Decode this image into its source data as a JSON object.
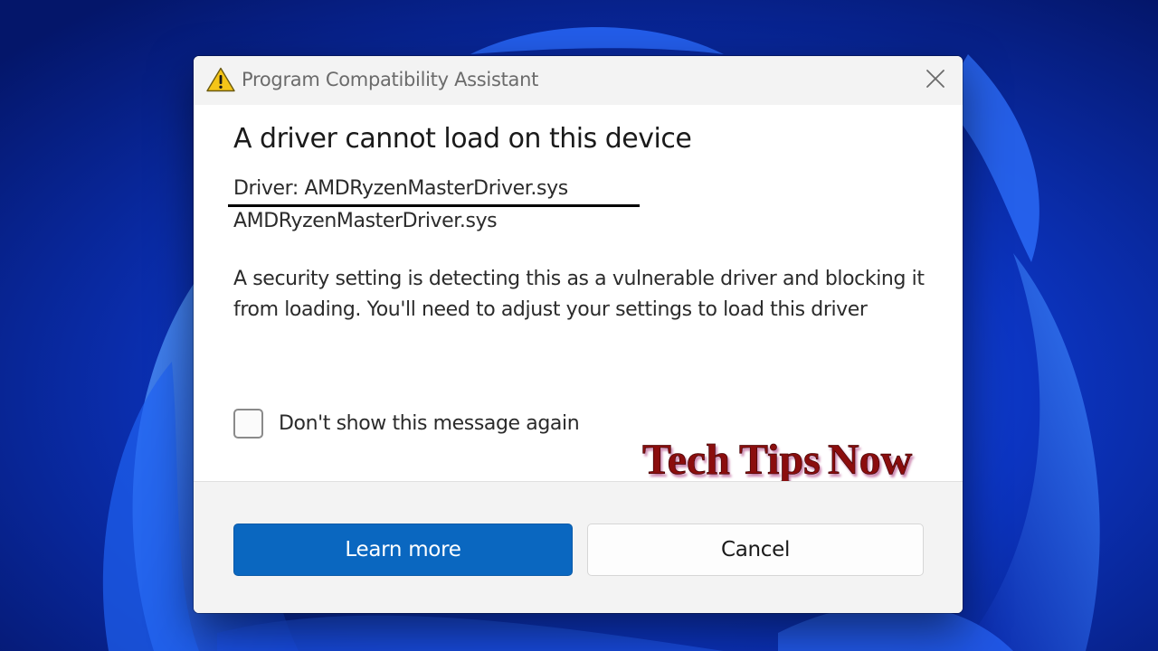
{
  "dialog": {
    "window_title": "Program Compatibility Assistant",
    "title_icon": "warning-icon",
    "close_icon": "close-icon",
    "heading": "A driver cannot load on this device",
    "driver_line": "Driver: AMDRyzenMasterDriver.sys",
    "driver_name": "AMDRyzenMasterDriver.sys",
    "description": "A security setting is detecting this as a vulnerable driver and blocking it from loading. You'll need to adjust your settings to load this driver",
    "checkbox": {
      "label": "Don't show this message again",
      "checked": false
    },
    "buttons": {
      "primary_label": "Learn more",
      "secondary_label": "Cancel"
    }
  },
  "watermark": {
    "text_parts": [
      "Tech",
      "Tips",
      "Now"
    ]
  },
  "colors": {
    "accent": "#0a67c0",
    "desktop_background": "#0a2a9a",
    "warning_yellow": "#f5c518",
    "watermark_red": "#8b1010"
  }
}
